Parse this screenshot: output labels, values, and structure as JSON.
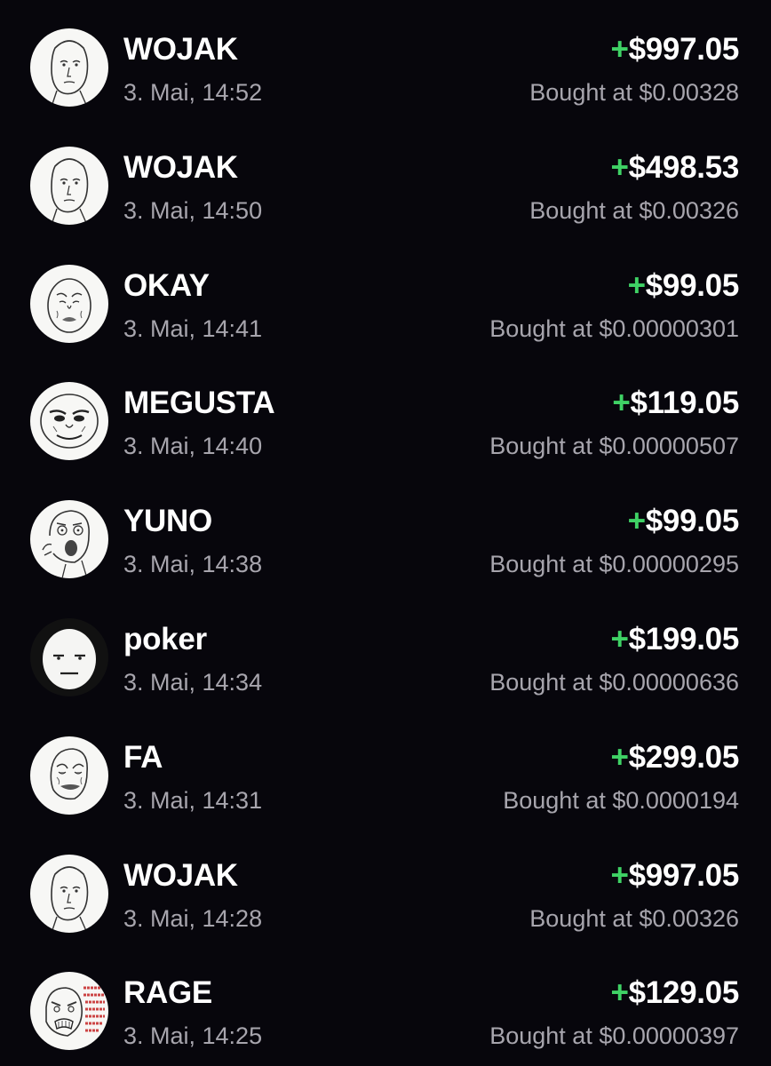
{
  "trades": [
    {
      "name": "WOJAK",
      "time": "3. Mai, 14:52",
      "sign": "+",
      "amount": "$997.05",
      "bought": "Bought at $0.00328",
      "icon": "wojak-face-icon"
    },
    {
      "name": "WOJAK",
      "time": "3. Mai, 14:50",
      "sign": "+",
      "amount": "$498.53",
      "bought": "Bought at $0.00326",
      "icon": "wojak-face-icon"
    },
    {
      "name": "OKAY",
      "time": "3. Mai, 14:41",
      "sign": "+",
      "amount": "$99.05",
      "bought": "Bought at $0.00000301",
      "icon": "okay-face-icon"
    },
    {
      "name": "MEGUSTA",
      "time": "3. Mai, 14:40",
      "sign": "+",
      "amount": "$119.05",
      "bought": "Bought at $0.00000507",
      "icon": "megusta-face-icon"
    },
    {
      "name": "YUNO",
      "time": "3. Mai, 14:38",
      "sign": "+",
      "amount": "$99.05",
      "bought": "Bought at $0.00000295",
      "icon": "yuno-face-icon"
    },
    {
      "name": "poker",
      "time": "3. Mai, 14:34",
      "sign": "+",
      "amount": "$199.05",
      "bought": "Bought at $0.00000636",
      "icon": "poker-face-icon"
    },
    {
      "name": "FA",
      "time": "3. Mai, 14:31",
      "sign": "+",
      "amount": "$299.05",
      "bought": "Bought at $0.0000194",
      "icon": "forever-alone-face-icon"
    },
    {
      "name": "WOJAK",
      "time": "3. Mai, 14:28",
      "sign": "+",
      "amount": "$997.05",
      "bought": "Bought at $0.00326",
      "icon": "wojak-face-icon"
    },
    {
      "name": "RAGE",
      "time": "3. Mai, 14:25",
      "sign": "+",
      "amount": "$129.05",
      "bought": "Bought at $0.00000397",
      "icon": "rage-face-icon"
    }
  ],
  "colors": {
    "background": "#07060c",
    "positive": "#3fd265",
    "secondary_text": "#a7a5ad"
  }
}
